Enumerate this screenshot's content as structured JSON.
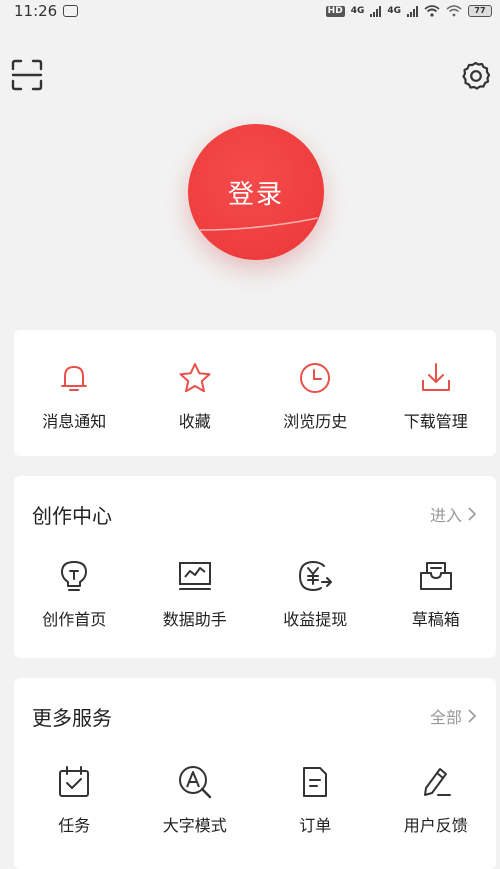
{
  "status_bar": {
    "time": "11:26",
    "network": "4G",
    "battery": "77"
  },
  "header": {
    "scan_icon": "scan-icon",
    "settings_icon": "gear-icon"
  },
  "login": {
    "label": "登录",
    "color": "#ee3d3d"
  },
  "quick_actions": [
    {
      "label": "消息通知",
      "icon": "bell-icon"
    },
    {
      "label": "收藏",
      "icon": "star-icon"
    },
    {
      "label": "浏览历史",
      "icon": "clock-icon"
    },
    {
      "label": "下载管理",
      "icon": "download-icon"
    }
  ],
  "creation_center": {
    "title": "创作中心",
    "link": "进入",
    "items": [
      {
        "label": "创作首页",
        "icon": "lightbulb-icon"
      },
      {
        "label": "数据助手",
        "icon": "chart-monitor-icon"
      },
      {
        "label": "收益提现",
        "icon": "yuan-withdraw-icon"
      },
      {
        "label": "草稿箱",
        "icon": "draft-box-icon"
      }
    ]
  },
  "more_services": {
    "title": "更多服务",
    "link": "全部",
    "items": [
      {
        "label": "任务",
        "icon": "task-calendar-icon"
      },
      {
        "label": "大字模式",
        "icon": "large-font-icon"
      },
      {
        "label": "订单",
        "icon": "order-doc-icon"
      },
      {
        "label": "用户反馈",
        "icon": "feedback-pen-icon"
      }
    ]
  },
  "colors": {
    "accent": "#e8514a",
    "icon_dark": "#333333",
    "background": "#f2f2f2"
  }
}
